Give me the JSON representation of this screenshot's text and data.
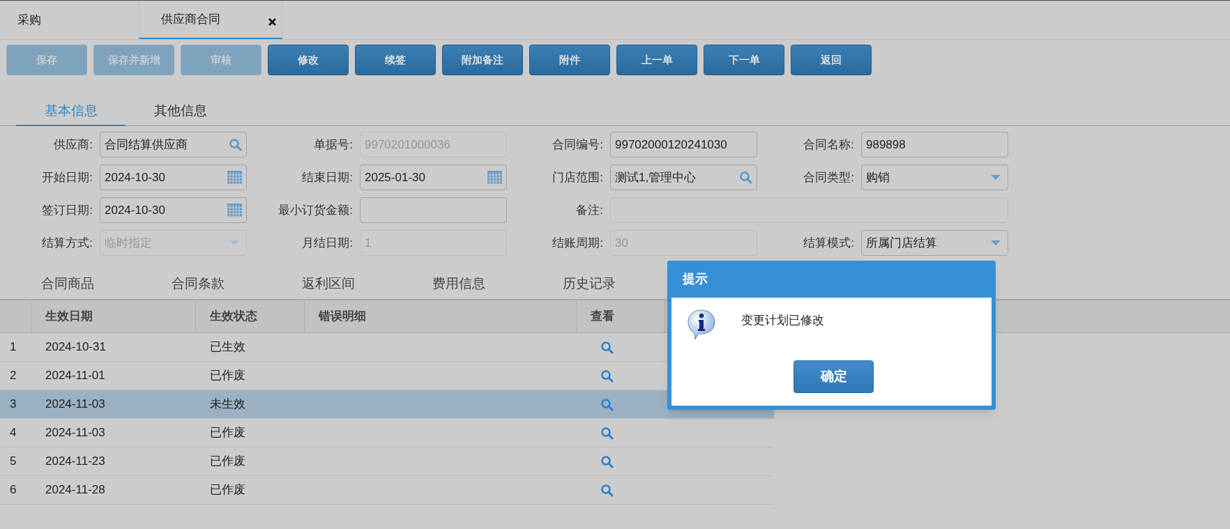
{
  "tabs": [
    {
      "label": "采购",
      "selected": false,
      "closable": false
    },
    {
      "label": "供应商合同",
      "selected": true,
      "closable": true
    }
  ],
  "toolbar": [
    {
      "label": "保存",
      "disabled": true
    },
    {
      "label": "保存并新增",
      "disabled": true
    },
    {
      "label": "审核",
      "disabled": true
    },
    {
      "label": "修改",
      "disabled": false
    },
    {
      "label": "续签",
      "disabled": false
    },
    {
      "label": "附加备注",
      "disabled": false
    },
    {
      "label": "附件",
      "disabled": false
    },
    {
      "label": "上一单",
      "disabled": false
    },
    {
      "label": "下一单",
      "disabled": false
    },
    {
      "label": "返回",
      "disabled": false
    }
  ],
  "info_tabs": [
    {
      "label": "基本信息",
      "selected": true
    },
    {
      "label": "其他信息",
      "selected": false
    }
  ],
  "form": {
    "rows": [
      [
        {
          "label": "供应商:",
          "value": "合同结算供应商",
          "kind": "search",
          "disabled": false
        },
        {
          "label": "单据号:",
          "value": "9970201000036",
          "kind": "text",
          "disabled": true
        },
        {
          "label": "合同编号:",
          "value": "99702000120241030",
          "kind": "text",
          "disabled": false
        },
        {
          "label": "合同名称:",
          "value": "989898",
          "kind": "text",
          "disabled": false
        }
      ],
      [
        {
          "label": "开始日期:",
          "value": "2024-10-30",
          "kind": "date",
          "disabled": false
        },
        {
          "label": "结束日期:",
          "value": "2025-01-30",
          "kind": "date",
          "disabled": false
        },
        {
          "label": "门店范围:",
          "value": "测试1,管理中心",
          "kind": "search",
          "disabled": false
        },
        {
          "label": "合同类型:",
          "value": "购销",
          "kind": "select",
          "disabled": false
        }
      ],
      [
        {
          "label": "签订日期:",
          "value": "2024-10-30",
          "kind": "date",
          "disabled": false
        },
        {
          "label": "最小订货金额:",
          "kind": "text",
          "disabled": false
        },
        {
          "label": "备注:",
          "kind": "wide",
          "disabled": true
        }
      ],
      [
        {
          "label": "结算方式:",
          "value": "临时指定",
          "kind": "select",
          "disabled": true
        },
        {
          "label": "月结日期:",
          "value": "1",
          "kind": "text",
          "disabled": true
        },
        {
          "label": "结账周期:",
          "value": "30",
          "kind": "text",
          "disabled": true
        },
        {
          "label": "结算模式:",
          "value": "所属门店结算",
          "kind": "select",
          "disabled": false
        }
      ]
    ]
  },
  "detail_tabs": [
    "合同商品",
    "合同条款",
    "返利区间",
    "费用信息",
    "历史记录"
  ],
  "table": {
    "columns": [
      "生效日期",
      "生效状态",
      "错误明细",
      "查看"
    ],
    "rows": [
      {
        "index": "1",
        "date": "2024-10-31",
        "status": "已生效",
        "selected": false
      },
      {
        "index": "2",
        "date": "2024-11-01",
        "status": "已作废",
        "selected": false
      },
      {
        "index": "3",
        "date": "2024-11-03",
        "status": "未生效",
        "selected": true
      },
      {
        "index": "4",
        "date": "2024-11-03",
        "status": "已作废",
        "selected": false
      },
      {
        "index": "5",
        "date": "2024-11-23",
        "status": "已作废",
        "selected": false
      },
      {
        "index": "6",
        "date": "2024-11-28",
        "status": "已作废",
        "selected": false
      }
    ]
  },
  "dialog": {
    "title": "提示",
    "message": "变更计划已修改",
    "button": "确定"
  }
}
